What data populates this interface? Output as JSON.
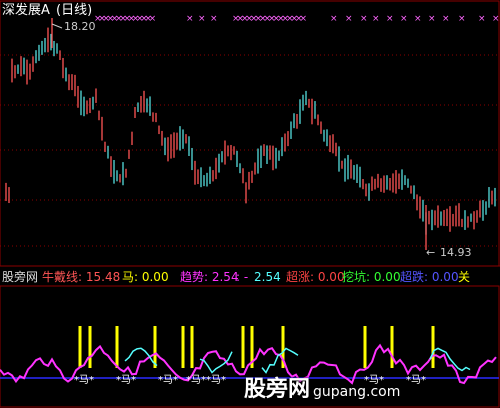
{
  "header": {
    "title": "深发展A",
    "period": "(日线)"
  },
  "price_chart": {
    "high_marker": "18.20",
    "low_marker": "14.93",
    "low_arrow": "←"
  },
  "indicator_bar": {
    "site_label": "股旁网",
    "items": [
      {
        "label": "牛戴线: ",
        "value": "15.48",
        "color": "#ff5555"
      },
      {
        "label": "马: ",
        "value": "0.00",
        "color": "#ffff00"
      },
      {
        "label": "趋势: ",
        "value": "2.54",
        "color": "#ff33ff"
      },
      {
        "label": "",
        "value": "2.54",
        "color": "#55ffff"
      },
      {
        "label": "超涨: ",
        "value": "0.00",
        "color": "#ff4444"
      },
      {
        "label": "挖坑: ",
        "value": "0.00",
        "color": "#33ff33"
      },
      {
        "label": "超跌: ",
        "value": "0.00",
        "color": "#5555ff"
      },
      {
        "label": "关",
        "value": "",
        "color": "#ffff00"
      }
    ]
  },
  "lower_panel": {
    "marker_text": "*马*"
  },
  "watermark": {
    "cn": "股旁网",
    "url": "gupang.com"
  }
}
